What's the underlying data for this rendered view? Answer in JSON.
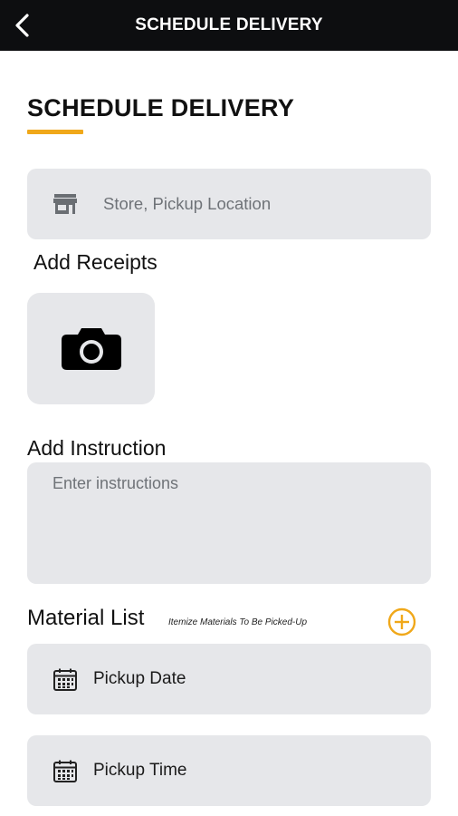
{
  "header": {
    "title": "SCHEDULE DELIVERY",
    "back_icon": "chevron-left-icon"
  },
  "page": {
    "heading": "SCHEDULE DELIVERY",
    "accent_color": "#f0a81a"
  },
  "store_field": {
    "icon": "store-icon",
    "placeholder": "Store, Pickup Location"
  },
  "receipts": {
    "label": "Add Receipts",
    "icon": "camera-icon"
  },
  "instruction": {
    "label": "Add Instruction",
    "placeholder": "Enter instructions"
  },
  "materials": {
    "label": "Material List",
    "hint": "Itemize Materials To Be Picked-Up",
    "add_icon": "plus-circle-icon"
  },
  "pickup_date": {
    "icon": "calendar-icon",
    "label": "Pickup Date"
  },
  "pickup_time": {
    "icon": "calendar-icon",
    "label": "Pickup Time"
  }
}
